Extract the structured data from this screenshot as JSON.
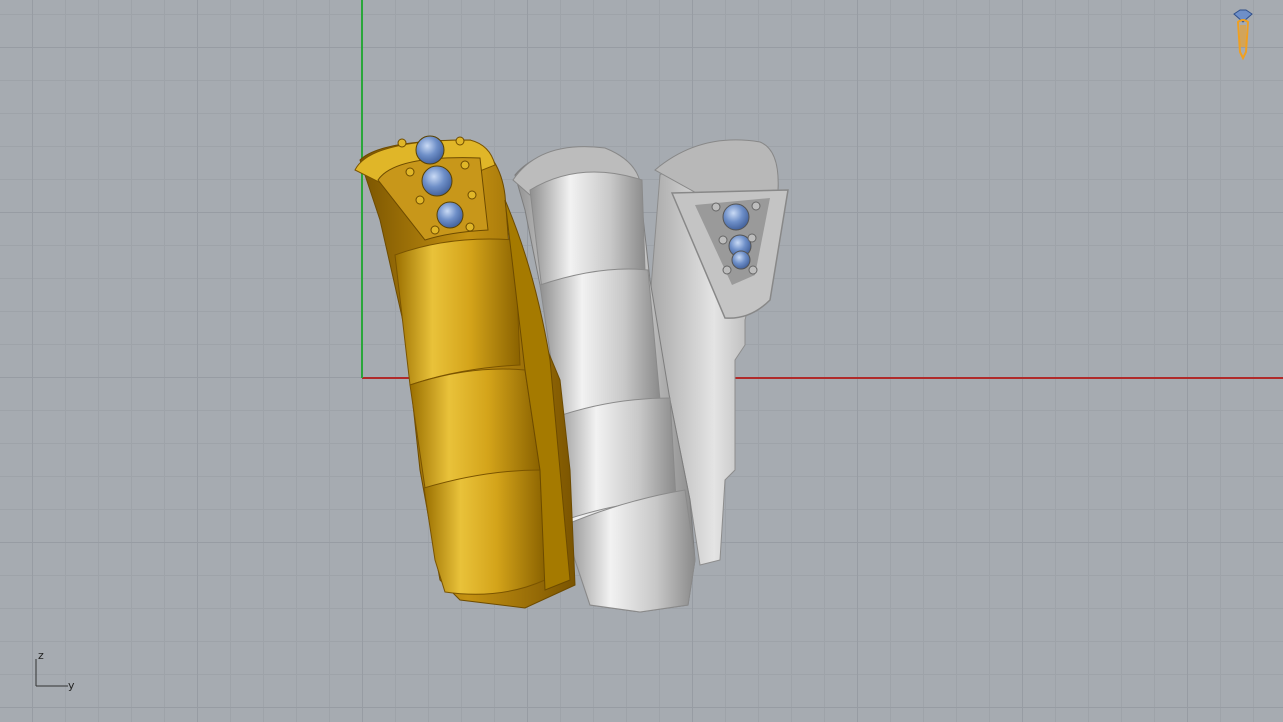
{
  "viewport": {
    "background_color": "#a6abb1",
    "grid_minor_color": "#9ea3a9",
    "grid_major_color": "#979ca3",
    "x_axis_color": "#b02a2a",
    "z_axis_color": "#2aa63a"
  },
  "model": {
    "objects": [
      {
        "name": "gold-ring",
        "material_color": "#d4a41a"
      },
      {
        "name": "silver-ring-front",
        "material_color": "#c9c9c9"
      },
      {
        "name": "silver-ring-back",
        "material_color": "#bdbdbd"
      }
    ],
    "gem_color": "#6e8fc8"
  },
  "axis_gizmo": {
    "vertical_label": "z",
    "horizontal_label": "y"
  },
  "display_mode_icon": {
    "icon": "ring-render-mode-icon",
    "color": "#f0a020"
  }
}
